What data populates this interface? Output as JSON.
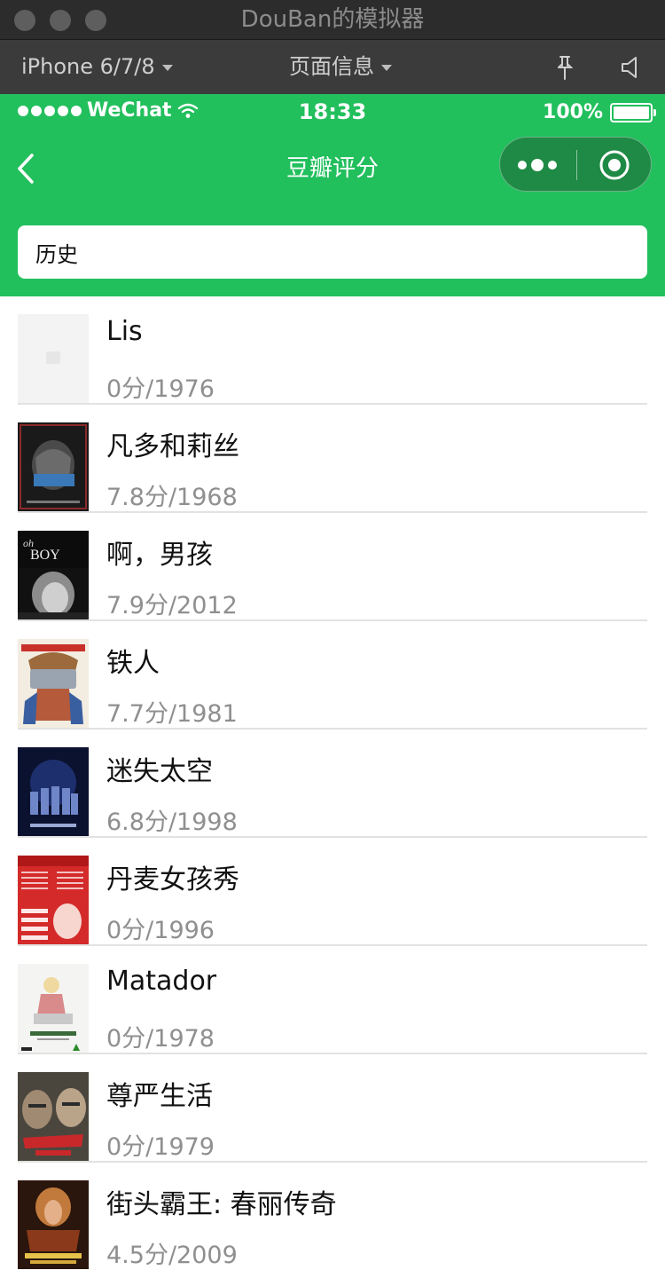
{
  "window": {
    "title": "DouBan的模拟器"
  },
  "toolbar": {
    "device": "iPhone 6/7/8",
    "page_info": "页面信息"
  },
  "status_bar": {
    "carrier": "WeChat",
    "time": "18:33",
    "battery": "100%"
  },
  "nav": {
    "title": "豆瓣评分"
  },
  "search": {
    "value": "历史",
    "placeholder": ""
  },
  "colors": {
    "brand_green": "#22bf5d",
    "capsule_green": "#1e8a45",
    "muted_text": "#8f8f8f"
  },
  "movies": [
    {
      "title": "Lis",
      "meta": "0分/1976",
      "poster": "placeholder"
    },
    {
      "title": "凡多和莉丝",
      "meta": "7.8分/1968",
      "poster": "poster-fando"
    },
    {
      "title": "啊，男孩",
      "meta": "7.9分/2012",
      "poster": "poster-oh-boy"
    },
    {
      "title": "铁人",
      "meta": "7.7分/1981",
      "poster": "poster-iron-man"
    },
    {
      "title": "迷失太空",
      "meta": "6.8分/1998",
      "poster": "poster-lost-in-space"
    },
    {
      "title": "丹麦女孩秀",
      "meta": "0分/1996",
      "poster": "poster-danish-girls"
    },
    {
      "title": "Matador",
      "meta": "0分/1978",
      "poster": "poster-matador"
    },
    {
      "title": "尊严生活",
      "meta": "0分/1979",
      "poster": "poster-dignity"
    },
    {
      "title": "街头霸王: 春丽传奇",
      "meta": "4.5分/2009",
      "poster": "poster-street-fighter"
    }
  ]
}
